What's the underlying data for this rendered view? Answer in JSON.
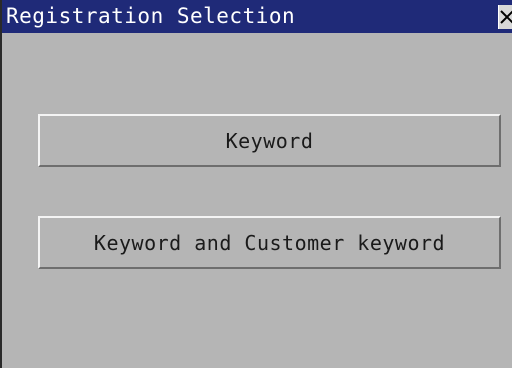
{
  "window": {
    "title": "Registration Selection",
    "close_icon": "close-icon"
  },
  "buttons": {
    "keyword_label": "Keyword",
    "keyword_customer_label": "Keyword and Customer keyword"
  },
  "colors": {
    "titlebar": "#1f2a78",
    "window_bg": "#b5b5b5",
    "title_text": "#ffffff"
  }
}
